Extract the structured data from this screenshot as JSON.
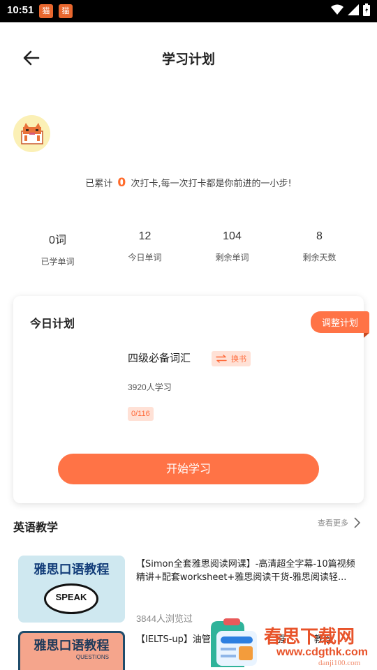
{
  "status_bar": {
    "time": "10:51"
  },
  "header": {
    "title": "学习计划"
  },
  "streak": {
    "prefix": "已累计",
    "count": "0",
    "suffix": "次打卡,每一次打卡都是你前进的一小步!"
  },
  "stats": [
    {
      "value": "0词",
      "label": "已学单词"
    },
    {
      "value": "12",
      "label": "今日单词"
    },
    {
      "value": "104",
      "label": "剩余单词"
    },
    {
      "value": "8",
      "label": "剩余天数"
    }
  ],
  "plan": {
    "title": "今日计划",
    "adjust_label": "调整计划",
    "book_name": "四级必备词汇",
    "swap_label": "换书",
    "learners": "3920人学习",
    "progress": "0/116",
    "start_label": "开始学习"
  },
  "teaching": {
    "title": "英语教学",
    "more_label": "查看更多",
    "items": [
      {
        "thumb_title": "雅思口语教程",
        "thumb_tag": "SPEAK",
        "title": "【Simon全套雅思阅读网课】-高清超全字幕-10篇视频精讲+配套worksheet+雅思阅读干货-雅思阅读轻...",
        "views": "3844人浏览过"
      },
      {
        "thumb_title": "雅思口语教程",
        "thumb_tag": "QUESTIONS",
        "title": "【IELTS-up】油管",
        "title_tail": "强",
        "title_tail2": "教程",
        "views": ""
      }
    ]
  },
  "watermark": {
    "text": "春思下载网",
    "url": "www.cdgthk.com",
    "sub": "danji100.com"
  },
  "colors": {
    "accent": "#ff7346",
    "accent_light": "#ffe1d6",
    "streak_num": "#ff6a2a"
  }
}
